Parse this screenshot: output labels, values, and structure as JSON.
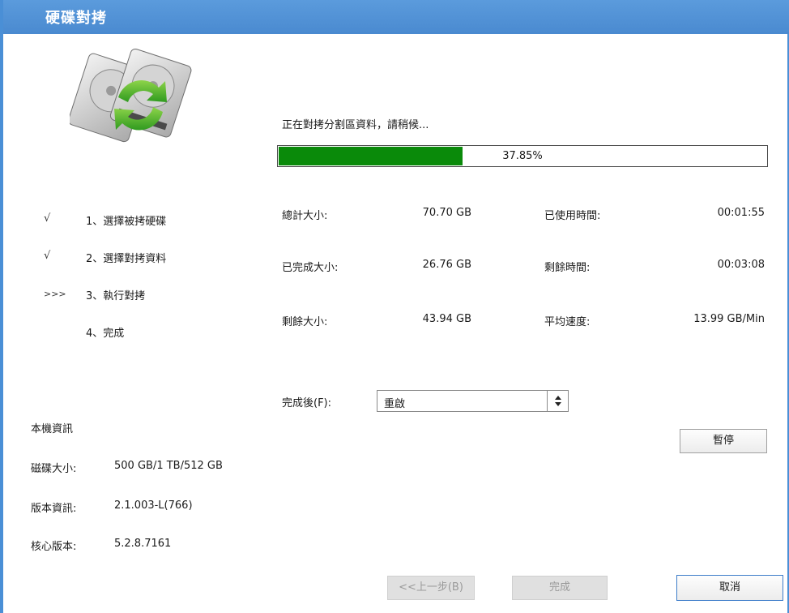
{
  "window": {
    "title": "硬碟對拷"
  },
  "steps": [
    {
      "mark": "√",
      "label": "1、選擇被拷硬碟"
    },
    {
      "mark": "√",
      "label": "2、選擇對拷資料"
    },
    {
      "mark": ">>>",
      "label": "3、執行對拷"
    },
    {
      "mark": "",
      "label": "4、完成"
    }
  ],
  "machine_info": {
    "heading": "本機資訊",
    "rows": [
      {
        "label": "磁碟大小:",
        "value": "500 GB/1 TB/512 GB"
      },
      {
        "label": "版本資訊:",
        "value": "2.1.003-L(766)"
      },
      {
        "label": "核心版本:",
        "value": "5.2.8.7161"
      }
    ]
  },
  "progress": {
    "status": "正在對拷分割區資料，請稍候...",
    "percent_text": "37.85%",
    "fraction": 0.3785
  },
  "stats": {
    "total_label": "總計大小:",
    "total_value": "70.70 GB",
    "done_label": "已完成大小:",
    "done_value": "26.76 GB",
    "remain_label": "剩餘大小:",
    "remain_value": "43.94 GB",
    "elapsed_label": "已使用時間:",
    "elapsed_value": "00:01:55",
    "left_label": "剩餘時間:",
    "left_value": "00:03:08",
    "speed_label": "平均速度:",
    "speed_value": "13.99 GB/Min"
  },
  "after": {
    "label": "完成後(F):",
    "selected": "重啟"
  },
  "buttons": {
    "pause": "暫停",
    "back": "<<上一步(B)",
    "finish": "完成",
    "cancel": "取消"
  },
  "colors": {
    "titlebar": "#4a8ad0",
    "progress_fill": "#0a8a0a"
  },
  "icons": {
    "illustration": "hdd-copy-icon",
    "select_arrow": "up-down-arrow-icon"
  }
}
